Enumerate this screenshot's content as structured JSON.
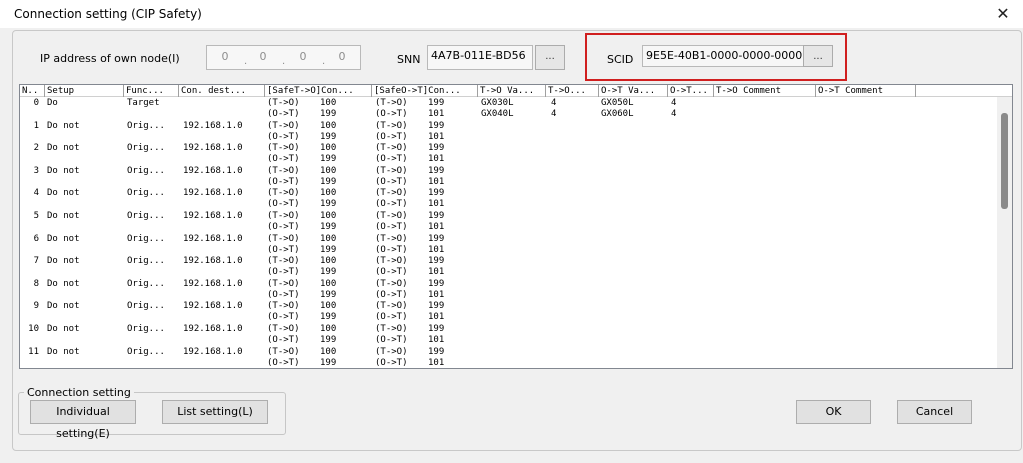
{
  "window": {
    "title": "Connection setting (CIP Safety)",
    "close_glyph": "✕"
  },
  "header": {
    "ip_label": "IP address of own node(I)",
    "ip_octets": [
      "0",
      "0",
      "0",
      "0"
    ],
    "snn_label": "SNN",
    "snn_value": "4A7B-011E-BD56",
    "scid_label": "SCID",
    "scid_value": "9E5E-40B1-0000-0000-0000",
    "dots_label": "..."
  },
  "table": {
    "columns": [
      "N..",
      "Setup",
      "Func...",
      "Con. dest...",
      "[SafeT->O]Con...",
      "[SafeO->T]Con...",
      "T->O Va...",
      "T->O...",
      "O->T Va...",
      "O->T...",
      "T->O Comment",
      "O->T Comment"
    ],
    "rows": [
      {
        "no": "0",
        "setup": "Do",
        "func": "Target",
        "dest": "",
        "st_a": "(T->O)",
        "st_a_v": "100",
        "st_b": "(O->T)",
        "st_b_v": "199",
        "so_a": "(T->O)",
        "so_a_v": "199",
        "so_b": "(O->T)",
        "so_b_v": "101",
        "to_va1": "GX030L",
        "to_n1": "4",
        "ot_va1": "GX050L",
        "ot_n1": "4",
        "to_va2": "GX040L",
        "to_n2": "4",
        "ot_va2": "GX060L",
        "ot_n2": "4"
      },
      {
        "no": "1",
        "setup": "Do not",
        "func": "Orig...",
        "dest": "192.168.1.0",
        "st_a": "(T->O)",
        "st_a_v": "100",
        "st_b": "(O->T)",
        "st_b_v": "199",
        "so_a": "(T->O)",
        "so_a_v": "199",
        "so_b": "(O->T)",
        "so_b_v": "101"
      },
      {
        "no": "2",
        "setup": "Do not",
        "func": "Orig...",
        "dest": "192.168.1.0",
        "st_a": "(T->O)",
        "st_a_v": "100",
        "st_b": "(O->T)",
        "st_b_v": "199",
        "so_a": "(T->O)",
        "so_a_v": "199",
        "so_b": "(O->T)",
        "so_b_v": "101"
      },
      {
        "no": "3",
        "setup": "Do not",
        "func": "Orig...",
        "dest": "192.168.1.0",
        "st_a": "(T->O)",
        "st_a_v": "100",
        "st_b": "(O->T)",
        "st_b_v": "199",
        "so_a": "(T->O)",
        "so_a_v": "199",
        "so_b": "(O->T)",
        "so_b_v": "101"
      },
      {
        "no": "4",
        "setup": "Do not",
        "func": "Orig...",
        "dest": "192.168.1.0",
        "st_a": "(T->O)",
        "st_a_v": "100",
        "st_b": "(O->T)",
        "st_b_v": "199",
        "so_a": "(T->O)",
        "so_a_v": "199",
        "so_b": "(O->T)",
        "so_b_v": "101"
      },
      {
        "no": "5",
        "setup": "Do not",
        "func": "Orig...",
        "dest": "192.168.1.0",
        "st_a": "(T->O)",
        "st_a_v": "100",
        "st_b": "(O->T)",
        "st_b_v": "199",
        "so_a": "(T->O)",
        "so_a_v": "199",
        "so_b": "(O->T)",
        "so_b_v": "101"
      },
      {
        "no": "6",
        "setup": "Do not",
        "func": "Orig...",
        "dest": "192.168.1.0",
        "st_a": "(T->O)",
        "st_a_v": "100",
        "st_b": "(O->T)",
        "st_b_v": "199",
        "so_a": "(T->O)",
        "so_a_v": "199",
        "so_b": "(O->T)",
        "so_b_v": "101"
      },
      {
        "no": "7",
        "setup": "Do not",
        "func": "Orig...",
        "dest": "192.168.1.0",
        "st_a": "(T->O)",
        "st_a_v": "100",
        "st_b": "(O->T)",
        "st_b_v": "199",
        "so_a": "(T->O)",
        "so_a_v": "199",
        "so_b": "(O->T)",
        "so_b_v": "101"
      },
      {
        "no": "8",
        "setup": "Do not",
        "func": "Orig...",
        "dest": "192.168.1.0",
        "st_a": "(T->O)",
        "st_a_v": "100",
        "st_b": "(O->T)",
        "st_b_v": "199",
        "so_a": "(T->O)",
        "so_a_v": "199",
        "so_b": "(O->T)",
        "so_b_v": "101"
      },
      {
        "no": "9",
        "setup": "Do not",
        "func": "Orig...",
        "dest": "192.168.1.0",
        "st_a": "(T->O)",
        "st_a_v": "100",
        "st_b": "(O->T)",
        "st_b_v": "199",
        "so_a": "(T->O)",
        "so_a_v": "199",
        "so_b": "(O->T)",
        "so_b_v": "101"
      },
      {
        "no": "10",
        "setup": "Do not",
        "func": "Orig...",
        "dest": "192.168.1.0",
        "st_a": "(T->O)",
        "st_a_v": "100",
        "st_b": "(O->T)",
        "st_b_v": "199",
        "so_a": "(T->O)",
        "so_a_v": "199",
        "so_b": "(O->T)",
        "so_b_v": "101"
      },
      {
        "no": "11",
        "setup": "Do not",
        "func": "Orig...",
        "dest": "192.168.1.0",
        "st_a": "(T->O)",
        "st_a_v": "100",
        "st_b": "(O->T)",
        "st_b_v": "199",
        "so_a": "(T->O)",
        "so_a_v": "199",
        "so_b": "(O->T)",
        "so_b_v": "101"
      }
    ]
  },
  "footer": {
    "group_label": "Connection setting",
    "individual_button": "Individual setting(E)",
    "list_button": "List setting(L)",
    "ok_button": "OK",
    "cancel_button": "Cancel"
  },
  "colors": {
    "highlight_frame": "#d01f1f"
  }
}
